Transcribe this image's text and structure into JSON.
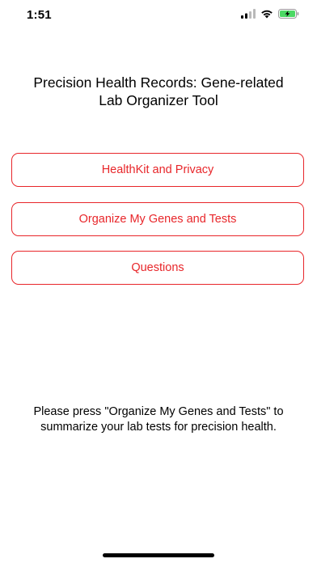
{
  "status_bar": {
    "time": "1:51",
    "icons": [
      "signal-icon",
      "wifi-icon",
      "battery-charging-icon"
    ]
  },
  "title": "Precision Health Records: Gene-related\nLab Organizer Tool",
  "buttons": {
    "healthkit_label": "HealthKit and Privacy",
    "organize_label": "Organize My Genes and Tests",
    "questions_label": "Questions"
  },
  "instructions": "Please press \"Organize My Genes and Tests\" to\nsummarize your lab tests for precision health.",
  "colors": {
    "accent": "#e8262a",
    "battery": "#4cd964"
  }
}
